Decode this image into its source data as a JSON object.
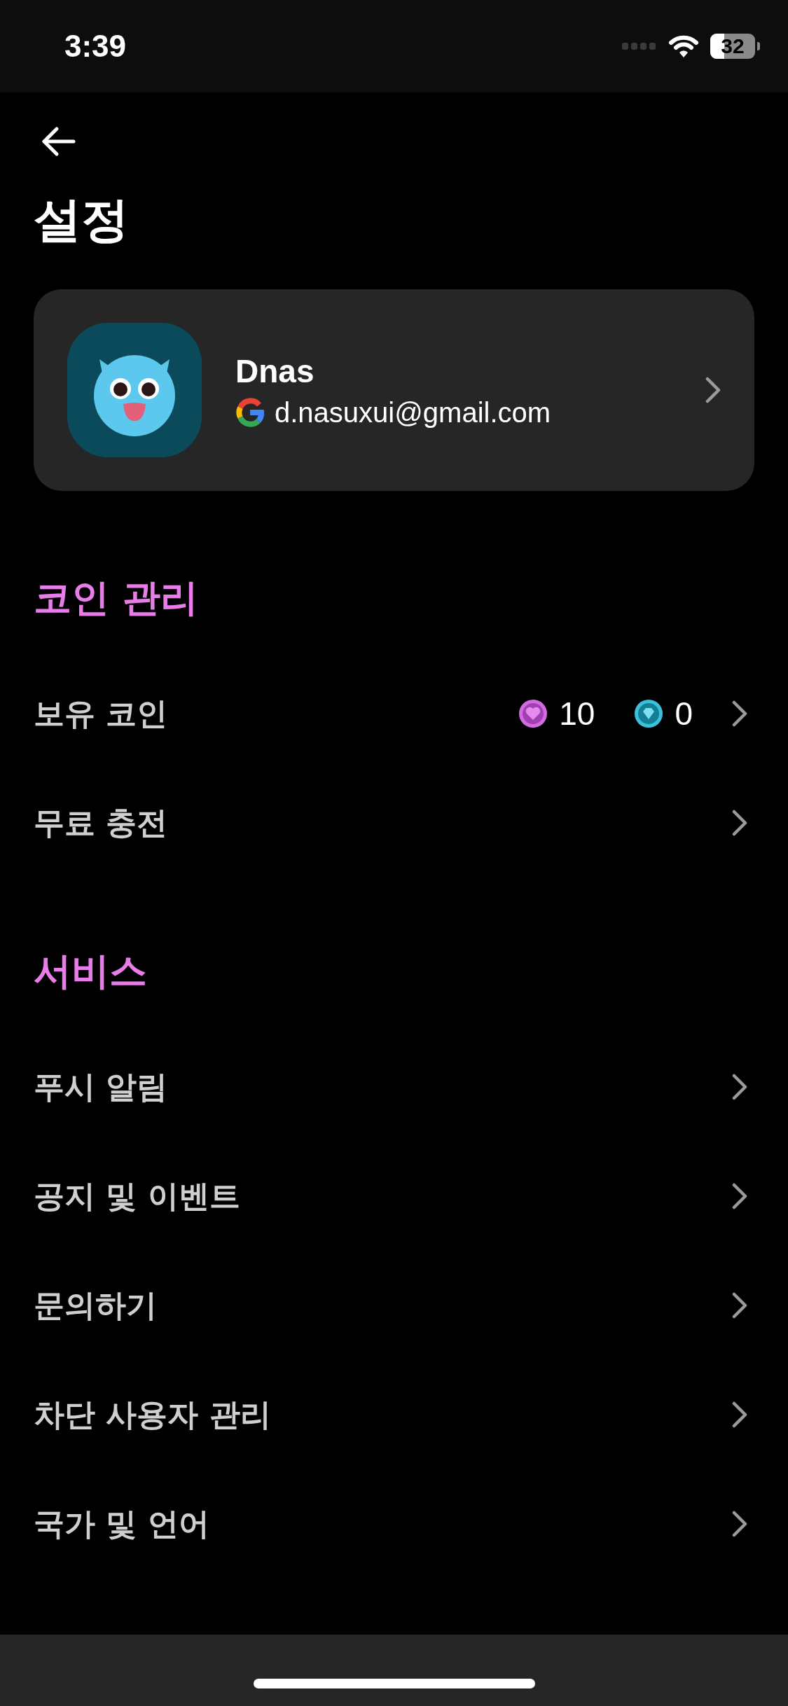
{
  "status_bar": {
    "time": "3:39",
    "battery": "32"
  },
  "header": {
    "title": "설정"
  },
  "profile": {
    "name": "Dnas",
    "email": "d.nasuxui@gmail.com"
  },
  "sections": [
    {
      "title": "코인 관리",
      "rows": [
        {
          "kind": "coins",
          "label": "보유 코인",
          "coins": [
            {
              "kind": "heart",
              "amount": "10"
            },
            {
              "kind": "diamond",
              "amount": "0"
            }
          ]
        },
        {
          "kind": "link",
          "label": "무료 충전"
        }
      ]
    },
    {
      "title": "서비스",
      "rows": [
        {
          "kind": "link",
          "label": "푸시 알림"
        },
        {
          "kind": "link",
          "label": "공지 및 이벤트"
        },
        {
          "kind": "link",
          "label": "문의하기"
        },
        {
          "kind": "link",
          "label": "차단 사용자 관리"
        },
        {
          "kind": "link",
          "label": "국가 및 언어"
        }
      ]
    }
  ]
}
